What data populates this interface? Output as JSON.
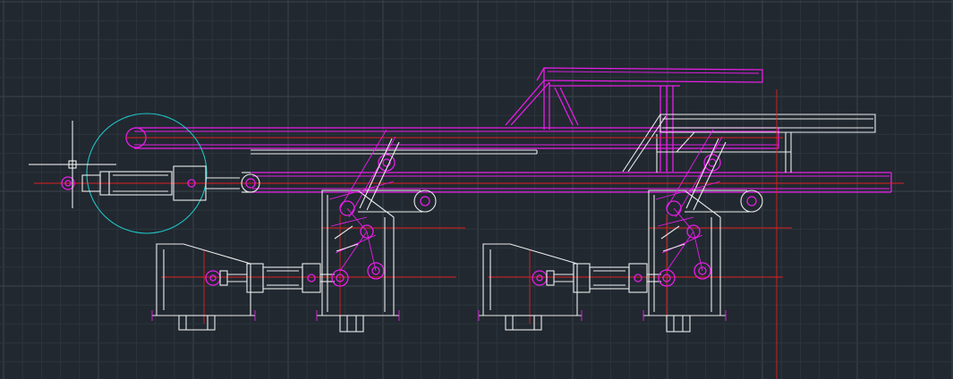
{
  "viewport": {
    "background": "#212830",
    "grid_major": "#3a434d",
    "grid_minor": "#2c343c"
  },
  "layers": {
    "magenta": "#e61ee6",
    "white": "#ececec",
    "red": "#e02020",
    "cyan": "#1fc5c5"
  },
  "cursor": {
    "type": "crosshair-icon"
  },
  "clamp_units": [
    "unit-1",
    "unit-2"
  ]
}
